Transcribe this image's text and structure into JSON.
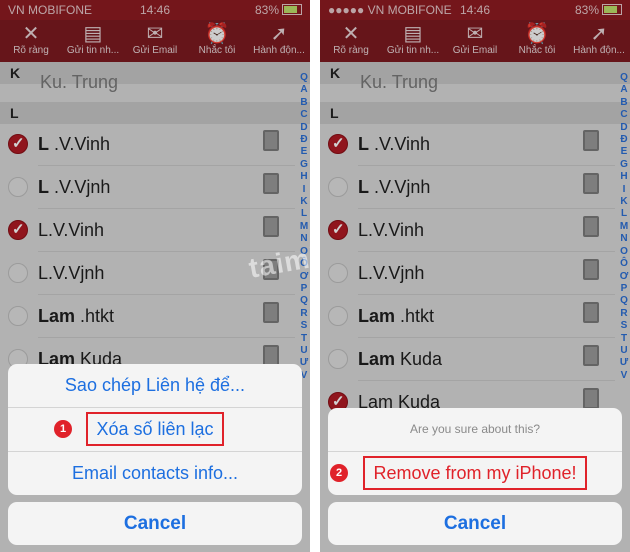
{
  "status": {
    "carrier": "VN MOBIFONE",
    "time": "14:46",
    "battery": "83%"
  },
  "toolbar": [
    {
      "label": "Rõ ràng",
      "icon": "close-icon"
    },
    {
      "label": "Gửi tin nh...",
      "icon": "message-icon"
    },
    {
      "label": "Gửi Email",
      "icon": "mail-icon"
    },
    {
      "label": "Nhắc tôi",
      "icon": "alarm-icon"
    },
    {
      "label": "Hành độn...",
      "icon": "action-arrow-icon"
    }
  ],
  "sections": {
    "k": "K",
    "l": "L"
  },
  "partial_name": "Ku. Trung",
  "left_contacts": [
    {
      "bold": "L",
      "rest": " .V.Vinh",
      "checked": true
    },
    {
      "bold": "L",
      "rest": " .V.Vjnh",
      "checked": false
    },
    {
      "bold": "",
      "rest": "L.V.Vinh",
      "checked": true
    },
    {
      "bold": "",
      "rest": "L.V.Vjnh",
      "checked": false
    },
    {
      "bold": "Lam",
      "rest": " .htkt",
      "checked": false
    },
    {
      "bold": "Lam",
      "rest": " Kuda",
      "checked": false
    }
  ],
  "right_contacts": [
    {
      "bold": "L",
      "rest": " .V.Vinh",
      "checked": true
    },
    {
      "bold": "L",
      "rest": " .V.Vjnh",
      "checked": false
    },
    {
      "bold": "",
      "rest": "L.V.Vinh",
      "checked": true
    },
    {
      "bold": "",
      "rest": "L.V.Vjnh",
      "checked": false
    },
    {
      "bold": "Lam",
      "rest": " .htkt",
      "checked": false
    },
    {
      "bold": "Lam",
      "rest": " Kuda",
      "checked": false
    },
    {
      "bold": "",
      "rest": "Lam Kuda",
      "checked": true
    }
  ],
  "index_letters": [
    "Q",
    "A",
    "B",
    "C",
    "D",
    "Đ",
    "E",
    "G",
    "H",
    "I",
    "K",
    "L",
    "M",
    "N",
    "O",
    "Ô",
    "Ơ",
    "P",
    "Q",
    "R",
    "S",
    "T",
    "U",
    "Ư",
    "V"
  ],
  "left_sheet": {
    "copy": "Sao chép Liên hệ để...",
    "delete": "Xóa số liên lạc",
    "email": "Email contacts info...",
    "step": "1"
  },
  "right_sheet": {
    "title": "Are you sure about this?",
    "remove": "Remove from my iPhone!",
    "step": "2"
  },
  "cancel": "Cancel",
  "watermark": "taimienphi"
}
